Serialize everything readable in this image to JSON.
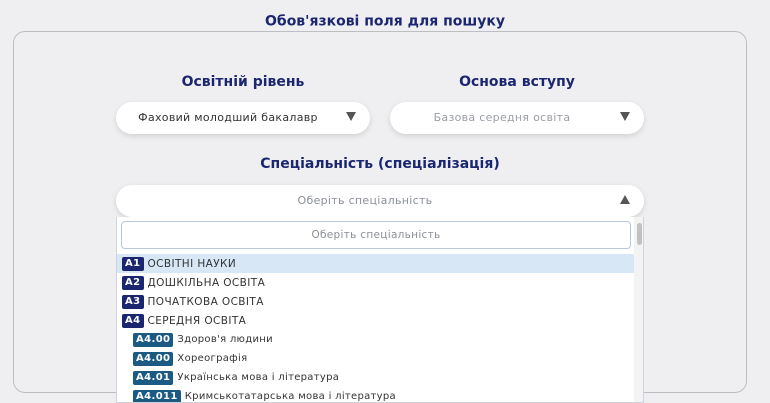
{
  "legend": "Обов'язкові поля для пошуку",
  "education_level": {
    "label": "Освітній рівень",
    "value": "Фаховий молодший бакалавр"
  },
  "admission_basis": {
    "label": "Основа вступу",
    "placeholder": "Базова середня освіта"
  },
  "specialty": {
    "label": "Спеціальність (спеціалізація)",
    "placeholder": "Оберіть спеціальність",
    "search_placeholder": "Оберіть спеціальність",
    "options": [
      {
        "code": "A1",
        "name": "ОСВІТНІ НАУКИ",
        "level": 1,
        "highlighted": true
      },
      {
        "code": "A2",
        "name": "ДОШКІЛЬНА ОСВІТА",
        "level": 1
      },
      {
        "code": "A3",
        "name": "ПОЧАТКОВА ОСВІТА",
        "level": 1
      },
      {
        "code": "A4",
        "name": "СЕРЕДНЯ ОСВІТА",
        "level": 1
      },
      {
        "code": "A4.00",
        "name": "Здоров'я людини",
        "level": 2
      },
      {
        "code": "A4.00",
        "name": "Хореографія",
        "level": 2
      },
      {
        "code": "A4.01",
        "name": "Українська мова і література",
        "level": 2
      },
      {
        "code": "A4.011",
        "name": "Кримськотатарська мова і література",
        "level": 2
      }
    ]
  },
  "colors": {
    "heading": "#1b2670",
    "highlight": "#d7e7f6",
    "code_dark": "#1b2670",
    "code_teal": "#1b5a82"
  }
}
